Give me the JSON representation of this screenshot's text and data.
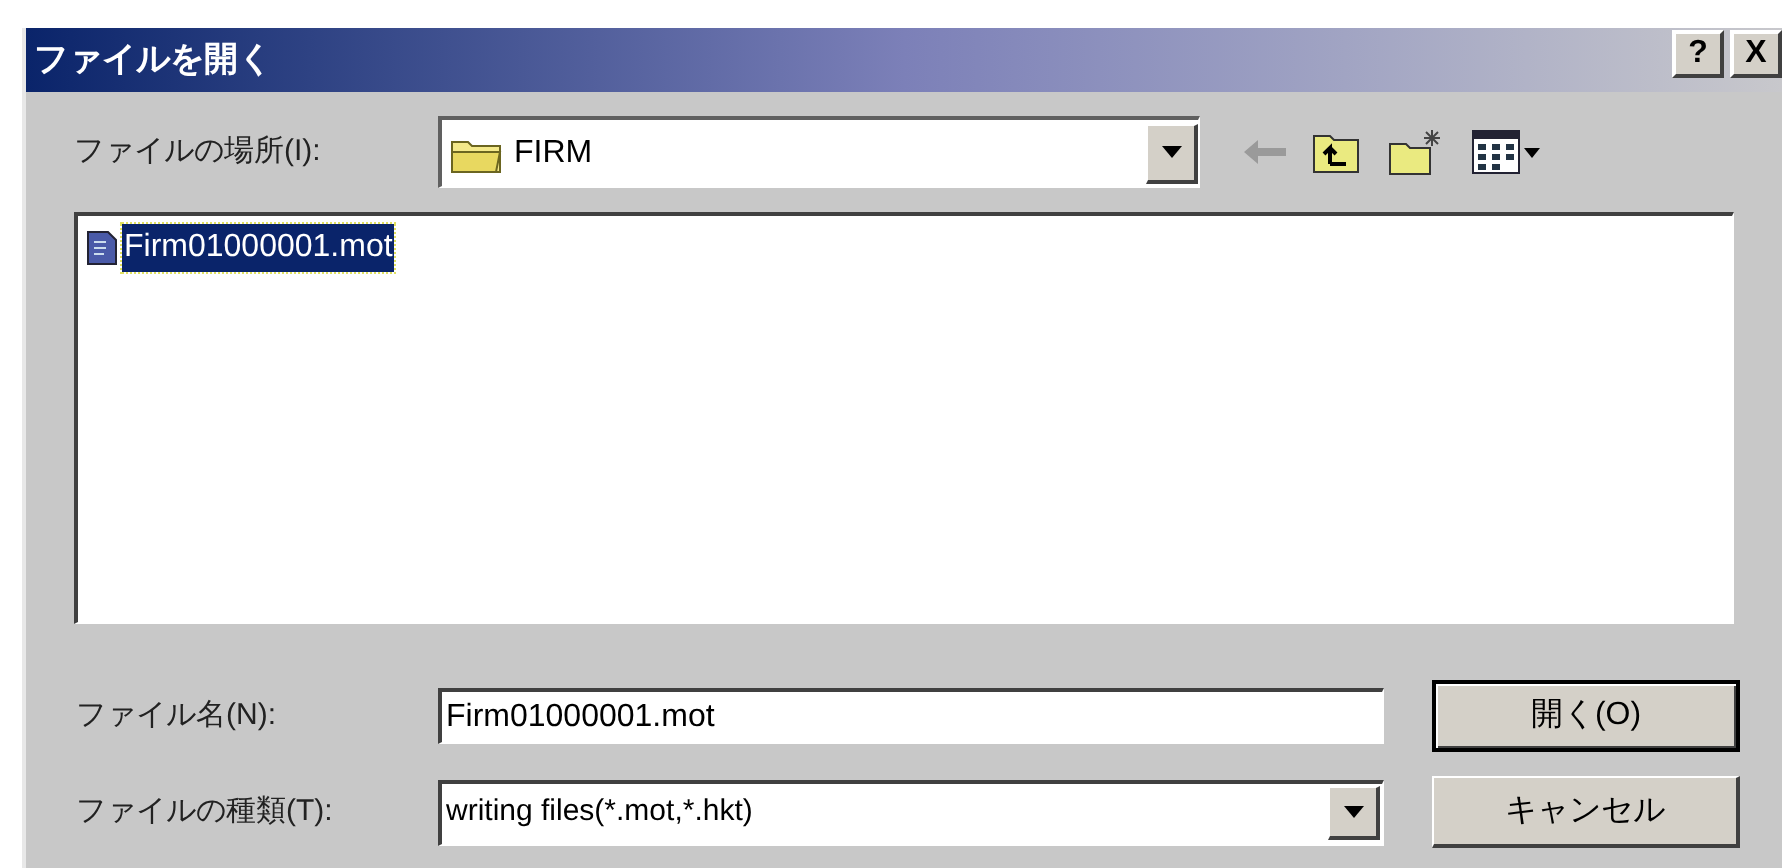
{
  "window": {
    "title": "ファイルを開く",
    "help": "?",
    "close": "X"
  },
  "location": {
    "label": "ファイルの場所(I):",
    "value": "FIRM"
  },
  "files": [
    {
      "name": "Firm01000001.mot",
      "selected": true
    }
  ],
  "file_name": {
    "label": "ファイル名(N):",
    "value": "Firm01000001.mot"
  },
  "file_type": {
    "label": "ファイルの種類(T):",
    "value": "writing files(*.mot,*.hkt)"
  },
  "buttons": [
    {
      "label": "開く(O)",
      "default": true
    },
    {
      "label": "キャンセル",
      "default": false
    }
  ]
}
